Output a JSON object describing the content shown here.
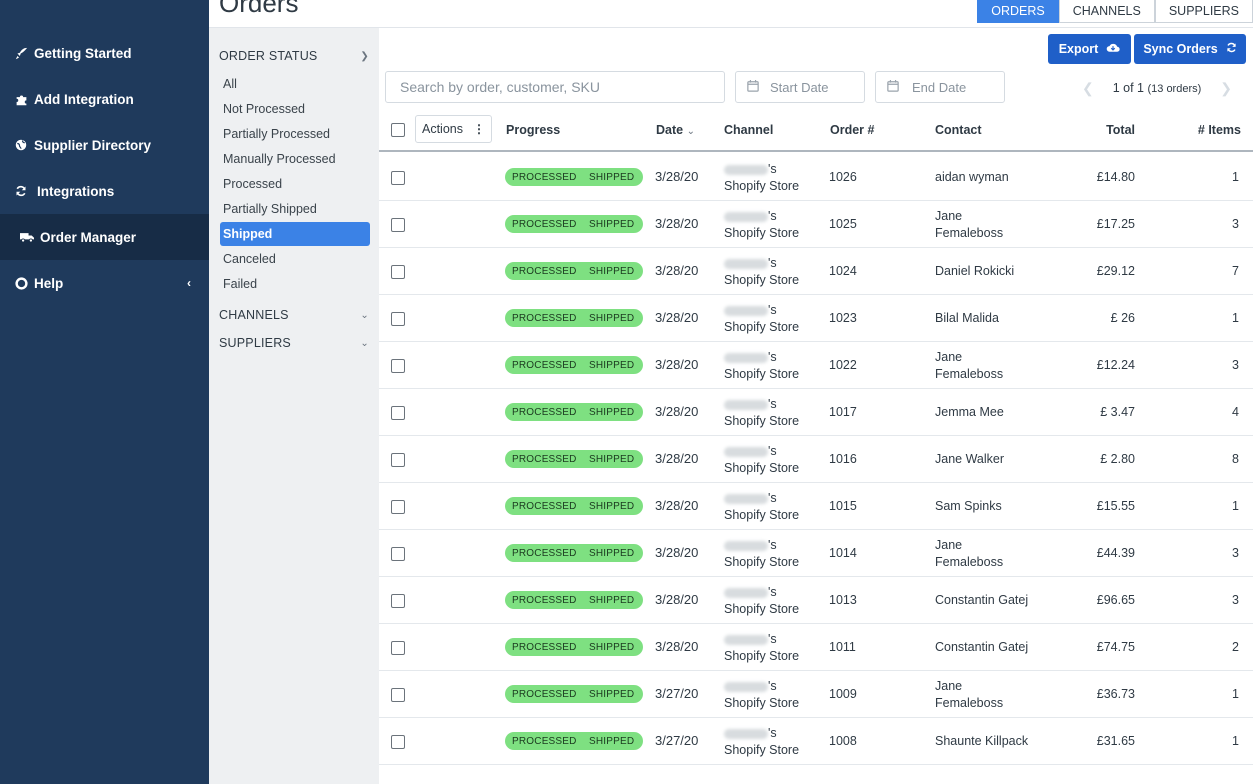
{
  "colors": {
    "sidebar_bg": "#1f3a5c",
    "accent": "#3b82e6",
    "button": "#1f5fc8",
    "progress_green": "#7ee081"
  },
  "sidebar": {
    "items": [
      {
        "label": "Getting Started",
        "icon": "rocket-icon"
      },
      {
        "label": "Add Integration",
        "icon": "puzzle-icon"
      },
      {
        "label": "Supplier Directory",
        "icon": "globe-icon"
      },
      {
        "label": "Integrations",
        "icon": "refresh-icon"
      },
      {
        "label": "Order Manager",
        "icon": "truck-icon",
        "active": true
      },
      {
        "label": "Help",
        "icon": "lifebuoy-icon"
      }
    ]
  },
  "header": {
    "title": "Orders",
    "tabs": [
      {
        "label": "ORDERS",
        "active": true
      },
      {
        "label": "CHANNELS"
      },
      {
        "label": "SUPPLIERS"
      }
    ]
  },
  "filters": {
    "order_status_title": "ORDER STATUS",
    "statuses": [
      {
        "label": "All"
      },
      {
        "label": "Not Processed"
      },
      {
        "label": "Partially Processed"
      },
      {
        "label": "Manually Processed"
      },
      {
        "label": "Processed"
      },
      {
        "label": "Partially Shipped"
      },
      {
        "label": "Shipped",
        "active": true
      },
      {
        "label": "Canceled"
      },
      {
        "label": "Failed"
      }
    ],
    "channels_title": "CHANNELS",
    "suppliers_title": "SUPPLIERS"
  },
  "toolbar": {
    "export_label": "Export",
    "sync_label": "Sync Orders",
    "search_placeholder": "Search by order, customer, SKU",
    "start_date_placeholder": "Start Date",
    "end_date_placeholder": "End Date",
    "pager_text": "1 of 1",
    "pager_count": "(13 orders)"
  },
  "table": {
    "columns": {
      "actions": "Actions",
      "progress": "Progress",
      "date": "Date",
      "channel": "Channel",
      "order": "Order #",
      "contact": "Contact",
      "total": "Total",
      "items": "# Items"
    },
    "rows": [
      {
        "progress": [
          "PROCESSED",
          "SHIPPED"
        ],
        "date": "3/28/20",
        "channel_suffix": "'s",
        "channel_line2": "Shopify Store",
        "order": "1026",
        "contact": [
          "aidan wyman"
        ],
        "total": "£14.80",
        "items": "1"
      },
      {
        "progress": [
          "PROCESSED",
          "SHIPPED"
        ],
        "date": "3/28/20",
        "channel_suffix": "'s",
        "channel_line2": "Shopify Store",
        "order": "1025",
        "contact": [
          "Jane",
          "Femaleboss"
        ],
        "total": "£17.25",
        "items": "3"
      },
      {
        "progress": [
          "PROCESSED",
          "SHIPPED"
        ],
        "date": "3/28/20",
        "channel_suffix": "'s",
        "channel_line2": "Shopify Store",
        "order": "1024",
        "contact": [
          "Daniel Rokicki"
        ],
        "total": "£29.12",
        "items": "7"
      },
      {
        "progress": [
          "PROCESSED",
          "SHIPPED"
        ],
        "date": "3/28/20",
        "channel_suffix": "'s",
        "channel_line2": "Shopify Store",
        "order": "1023",
        "contact": [
          "Bilal Malida"
        ],
        "total": "£ 26",
        "items": "1"
      },
      {
        "progress": [
          "PROCESSED",
          "SHIPPED"
        ],
        "date": "3/28/20",
        "channel_suffix": "'s",
        "channel_line2": "Shopify Store",
        "order": "1022",
        "contact": [
          "Jane",
          "Femaleboss"
        ],
        "total": "£12.24",
        "items": "3"
      },
      {
        "progress": [
          "PROCESSED",
          "SHIPPED"
        ],
        "date": "3/28/20",
        "channel_suffix": "'s",
        "channel_line2": "Shopify Store",
        "order": "1017",
        "contact": [
          "Jemma Mee"
        ],
        "total": "£ 3.47",
        "items": "4"
      },
      {
        "progress": [
          "PROCESSED",
          "SHIPPED"
        ],
        "date": "3/28/20",
        "channel_suffix": "'s",
        "channel_line2": "Shopify Store",
        "order": "1016",
        "contact": [
          "Jane Walker"
        ],
        "total": "£ 2.80",
        "items": "8"
      },
      {
        "progress": [
          "PROCESSED",
          "SHIPPED"
        ],
        "date": "3/28/20",
        "channel_suffix": "'s",
        "channel_line2": "Shopify Store",
        "order": "1015",
        "contact": [
          "Sam Spinks"
        ],
        "total": "£15.55",
        "items": "1"
      },
      {
        "progress": [
          "PROCESSED",
          "SHIPPED"
        ],
        "date": "3/28/20",
        "channel_suffix": "'s",
        "channel_line2": "Shopify Store",
        "order": "1014",
        "contact": [
          "Jane",
          "Femaleboss"
        ],
        "total": "£44.39",
        "items": "3"
      },
      {
        "progress": [
          "PROCESSED",
          "SHIPPED"
        ],
        "date": "3/28/20",
        "channel_suffix": "'s",
        "channel_line2": "Shopify Store",
        "order": "1013",
        "contact": [
          "Constantin Gatej"
        ],
        "total": "£96.65",
        "items": "3"
      },
      {
        "progress": [
          "PROCESSED",
          "SHIPPED"
        ],
        "date": "3/28/20",
        "channel_suffix": "'s",
        "channel_line2": "Shopify Store",
        "order": "1011",
        "contact": [
          "Constantin Gatej"
        ],
        "total": "£74.75",
        "items": "2"
      },
      {
        "progress": [
          "PROCESSED",
          "SHIPPED"
        ],
        "date": "3/27/20",
        "channel_suffix": "'s",
        "channel_line2": "Shopify Store",
        "order": "1009",
        "contact": [
          "Jane",
          "Femaleboss"
        ],
        "total": "£36.73",
        "items": "1"
      },
      {
        "progress": [
          "PROCESSED",
          "SHIPPED"
        ],
        "date": "3/27/20",
        "channel_suffix": "'s",
        "channel_line2": "Shopify Store",
        "order": "1008",
        "contact": [
          "Shaunte Killpack"
        ],
        "total": "£31.65",
        "items": "1"
      }
    ]
  }
}
